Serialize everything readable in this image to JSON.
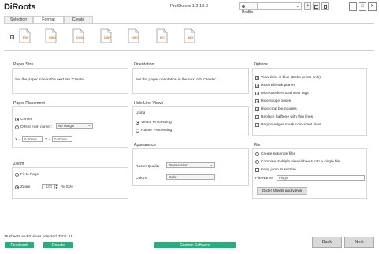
{
  "app": {
    "logo": "DiRoots",
    "title": "ProSheets 1.2.18.0"
  },
  "profile": {
    "label": "Profile",
    "value": ""
  },
  "profile_buttons": {
    "add": "+",
    "save": "▦",
    "delete": "🗑"
  },
  "window_buttons": {
    "minimize": "—",
    "maximize": "□",
    "close": "✕"
  },
  "tabs": [
    "Selection",
    "Format",
    "Create"
  ],
  "formats": [
    {
      "label": "PDF",
      "checked": true
    },
    {
      "label": "DWG",
      "checked": false
    },
    {
      "label": "DGN",
      "checked": false
    },
    {
      "label": "DWF",
      "checked": false
    },
    {
      "label": "NWC",
      "checked": false
    },
    {
      "label": "IFC",
      "checked": false
    },
    {
      "label": "IMG",
      "checked": false
    }
  ],
  "paper_size": {
    "title": "Paper Size",
    "desc": "Set the paper size in the next tab 'Create'."
  },
  "orientation": {
    "title": "Orientation",
    "desc": "Set the paper orientation in the next tab 'Create'."
  },
  "placement": {
    "title": "Paper Placement",
    "center": "Center",
    "offset": "Offset from corner:",
    "margin_select": "No Margin",
    "x_label": "X =",
    "x_value": "0.00mm",
    "y_label": "Y =",
    "y_value": "0.00mm"
  },
  "hidden_lines": {
    "title": "Hide Line Views",
    "using": "Using",
    "vector": "Vector Processing",
    "raster": "Raster Processing"
  },
  "appearance": {
    "title": "Appearance",
    "raster_label": "Raster Quality",
    "raster_value": "Presentation",
    "colors_label": "Colors",
    "colors_value": "Color"
  },
  "zoom": {
    "title": "Zoom",
    "fit": "Fit to Page",
    "zoom": "Zoom",
    "zoom_value": "100",
    "size_label": "% Size"
  },
  "options": {
    "title": "Options",
    "items": [
      {
        "label": "View links in blue (Color prints only)",
        "checked": true
      },
      {
        "label": "Hide ref/work planes",
        "checked": true
      },
      {
        "label": "Hide unreferenced view tags",
        "checked": true
      },
      {
        "label": "Hide scope boxes",
        "checked": true
      },
      {
        "label": "Hide crop boundaries",
        "checked": true
      },
      {
        "label": "Replace halftone with thin lines",
        "checked": false
      },
      {
        "label": "Region edges mask coincident lines",
        "checked": false
      }
    ]
  },
  "file": {
    "title": "File",
    "separate": "Create separate files",
    "combine": "Combine multiple views/sheets into a single file",
    "keep": "Keep jump to section",
    "name_label": "File Name",
    "name_value": "Plugin",
    "order_button": "Order sheets and views"
  },
  "footer": {
    "status": "15 sheets and 0 views selected. Total: 15",
    "feedback": "Feedback",
    "donate": "Donate",
    "custom": "Custom Software",
    "back": "Back",
    "next": "Next"
  },
  "colors": {
    "accent_green": "#23b07a",
    "pdf_orange": "#e8801e"
  }
}
